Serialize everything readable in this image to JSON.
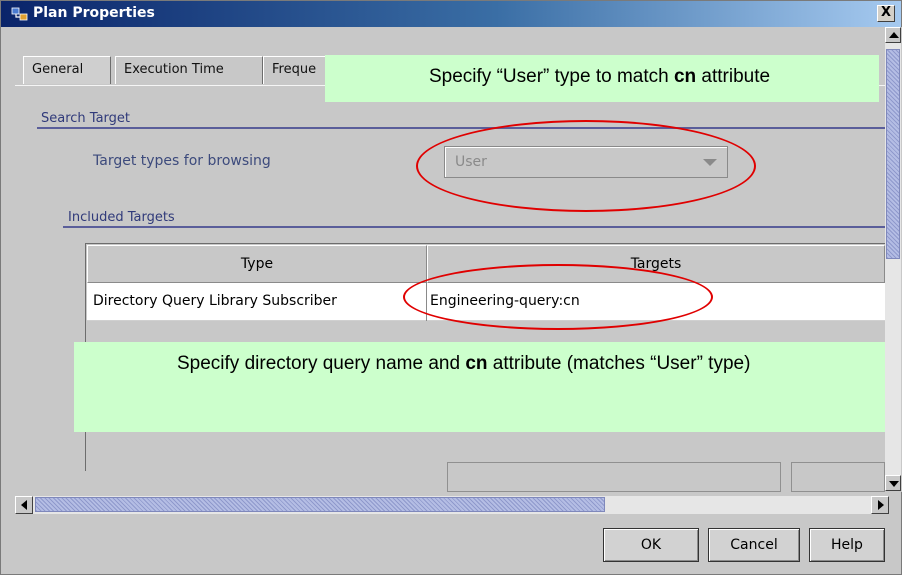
{
  "window": {
    "title": "Plan Properties",
    "close_label": "X"
  },
  "tabs": [
    {
      "label": "General"
    },
    {
      "label": "Execution Time"
    },
    {
      "label": "Freque"
    }
  ],
  "search_target": {
    "section_title": "Search Target",
    "field_label": "Target types for browsing",
    "combo_value": "User"
  },
  "included_targets": {
    "section_title": "Included Targets",
    "columns": [
      "Type",
      "Targets"
    ],
    "rows": [
      {
        "type": "Directory Query Library Subscriber",
        "targets": "Engineering-query:cn"
      }
    ]
  },
  "annotations": {
    "callout1": {
      "pre": "Specify “User” type to match ",
      "bold": "cn",
      "post": " attribute"
    },
    "callout2": {
      "pre": "Specify directory query name and ",
      "bold": "cn",
      "post": " attribute (matches “User” type)"
    }
  },
  "buttons": {
    "ok": "OK",
    "cancel": "Cancel",
    "help": "Help"
  },
  "colors": {
    "title_bar": "#0a246a",
    "callout_bg": "#ccffcc",
    "highlight_ellipse": "#e00000",
    "section_line": "#5a5e9a"
  }
}
